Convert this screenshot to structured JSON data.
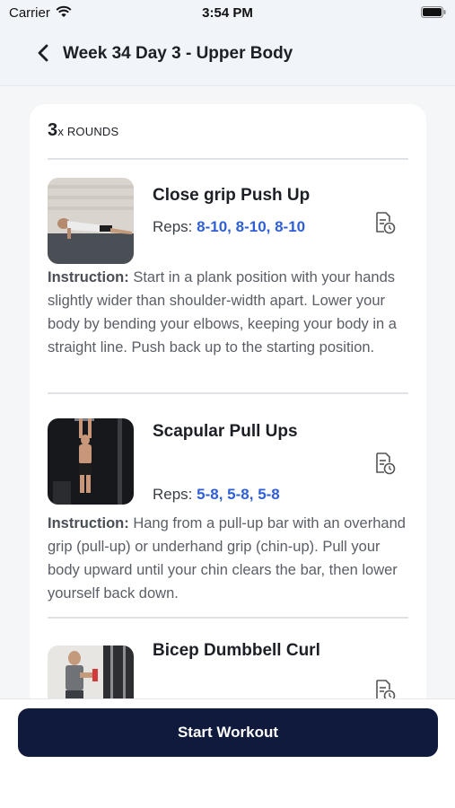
{
  "status_bar": {
    "carrier": "Carrier",
    "time": "3:54 PM"
  },
  "header": {
    "title": "Week 34 Day 3 - Upper Body"
  },
  "rounds": {
    "count": "3",
    "x": "x",
    "label": "ROUNDS"
  },
  "exercises": [
    {
      "name": "Close grip Push Up",
      "reps_label": "Reps:",
      "reps_value": "8-10, 8-10, 8-10",
      "instruction_label": "Instruction:",
      "instruction_text": "Start in a plank position with your hands slightly wider than shoulder-width apart. Lower your body by bending your elbows, keeping your body in a straight line. Push back up to the starting position."
    },
    {
      "name": "Scapular Pull Ups",
      "reps_label": "Reps:",
      "reps_value": "5-8, 5-8, 5-8",
      "instruction_label": "Instruction:",
      "instruction_text": "Hang from a pull-up bar with an overhand grip (pull-up) or underhand grip (chin-up). Pull your body upward until your chin clears the bar, then lower yourself back down."
    },
    {
      "name": "Bicep Dumbbell Curl"
    }
  ],
  "footer": {
    "start_label": "Start Workout"
  },
  "colors": {
    "accent": "#2f5fd6",
    "button": "#0f1a3d",
    "background": "#f5f6f8"
  }
}
